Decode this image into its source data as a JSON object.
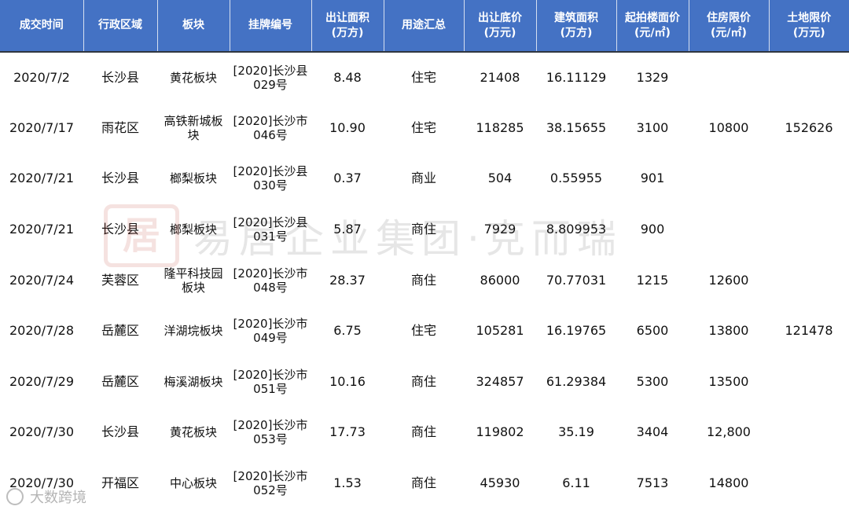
{
  "table": {
    "headers": [
      [
        "成交时间"
      ],
      [
        "行政区域"
      ],
      [
        "板块"
      ],
      [
        "挂牌编号"
      ],
      [
        "出让面积",
        "(万方)"
      ],
      [
        "用途汇总"
      ],
      [
        "出让底价",
        "(万元)"
      ],
      [
        "建筑面积",
        "(万方)"
      ],
      [
        "起拍楼面价",
        "(元/㎡)"
      ],
      [
        "住房限价",
        "(元/㎡)"
      ],
      [
        "土地限价",
        "(万元)"
      ]
    ],
    "rows": [
      [
        "2020/7/2",
        "长沙县",
        "黄花板块",
        "[2020]长沙县029号",
        "8.48",
        "住宅",
        "21408",
        "16.11129",
        "1329",
        "",
        ""
      ],
      [
        "2020/7/17",
        "雨花区",
        "高铁新城板块",
        "[2020]长沙市046号",
        "10.90",
        "住宅",
        "118285",
        "38.15655",
        "3100",
        "10800",
        "152626"
      ],
      [
        "2020/7/21",
        "长沙县",
        "榔梨板块",
        "[2020]长沙县030号",
        "0.37",
        "商业",
        "504",
        "0.55955",
        "901",
        "",
        ""
      ],
      [
        "2020/7/21",
        "长沙县",
        "榔梨板块",
        "[2020]长沙县031号",
        "5.87",
        "商住",
        "7929",
        "8.809953",
        "900",
        "",
        ""
      ],
      [
        "2020/7/24",
        "芙蓉区",
        "隆平科技园板块",
        "[2020]长沙市048号",
        "28.37",
        "商住",
        "86000",
        "70.77031",
        "1215",
        "12600",
        ""
      ],
      [
        "2020/7/28",
        "岳麓区",
        "洋湖垸板块",
        "[2020]长沙市049号",
        "6.75",
        "住宅",
        "105281",
        "16.19765",
        "6500",
        "13800",
        "121478"
      ],
      [
        "2020/7/29",
        "岳麓区",
        "梅溪湖板块",
        "[2020]长沙市051号",
        "10.16",
        "商住",
        "324857",
        "61.29384",
        "5300",
        "13500",
        ""
      ],
      [
        "2020/7/30",
        "长沙县",
        "黄花板块",
        "[2020]长沙市053号",
        "17.73",
        "商住",
        "119802",
        "35.19",
        "3404",
        "12,800",
        ""
      ],
      [
        "2020/7/30",
        "开福区",
        "中心板块",
        "[2020]长沙市052号",
        "1.53",
        "商住",
        "45930",
        "6.11",
        "7513",
        "14800",
        ""
      ]
    ]
  },
  "watermark": {
    "seal_char": "居",
    "text": "易居企业集团·克而瑞"
  },
  "source_mark": {
    "text": "大数跨境"
  },
  "colors": {
    "header_bg": "#4472c4",
    "header_text": "#ffffff"
  }
}
